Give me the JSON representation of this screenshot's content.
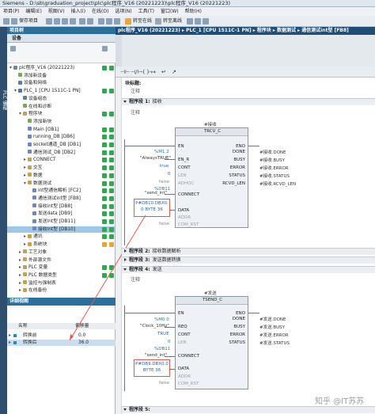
{
  "window": {
    "title": "Siemens - D:\\sb\\graduation_project\\plc\\plc程序_V16 (20221223)\\plc程序_V16 (20221223)"
  },
  "menu": [
    "项目(P)",
    "编辑(E)",
    "视图(V)",
    "插入(I)",
    "在线(O)",
    "选项(N)",
    "工具(T)",
    "窗口(W)",
    "帮助(H)"
  ],
  "toolbar": {
    "save_label": "保存项目",
    "go_online": "转至在线",
    "go_offline": "转至离线"
  },
  "left_tab": "PLC 编程",
  "project_tree": {
    "header": "项目树",
    "device_tab": "设备",
    "items": [
      {
        "label": "plc程序_V16 (20221223)",
        "indent": 0,
        "open": true,
        "icon": "#6a88a6",
        "status": "g"
      },
      {
        "label": "添加新设备",
        "indent": 1,
        "open": null,
        "icon": "#7aa85a",
        "status": ""
      },
      {
        "label": "设备和网络",
        "indent": 1,
        "open": null,
        "icon": "#5a7ea6",
        "status": ""
      },
      {
        "label": "PLC_1 [CPU 1511C-1 PN]",
        "indent": 1,
        "open": true,
        "icon": "#4a7a9a",
        "status": "g"
      },
      {
        "label": "设备组态",
        "indent": 2,
        "open": null,
        "icon": "#5a7ea6",
        "status": ""
      },
      {
        "label": "在线和诊断",
        "indent": 2,
        "open": null,
        "icon": "#7aa85a",
        "status": ""
      },
      {
        "label": "程序块",
        "indent": 2,
        "open": true,
        "icon": "#c8a04a",
        "status": "g"
      },
      {
        "label": "添加新块",
        "indent": 3,
        "open": null,
        "icon": "#7aa85a",
        "status": ""
      },
      {
        "label": "Main [OB1]",
        "indent": 3,
        "open": null,
        "icon": "#6a88c6",
        "status": "g"
      },
      {
        "label": "running_DB [DB6]",
        "indent": 3,
        "open": null,
        "icon": "#6a88c6",
        "status": "g"
      },
      {
        "label": "socket通道_DB [DB1]",
        "indent": 3,
        "open": null,
        "icon": "#6a88c6",
        "status": "g"
      },
      {
        "label": "通信测试_DB [DB2]",
        "indent": 3,
        "open": null,
        "icon": "#6a88c6",
        "status": "g"
      },
      {
        "label": "CONNECT",
        "indent": 3,
        "open": false,
        "icon": "#c8a04a",
        "status": "g"
      },
      {
        "label": "交互",
        "indent": 3,
        "open": false,
        "icon": "#c8a04a",
        "status": "g"
      },
      {
        "label": "数据",
        "indent": 3,
        "open": false,
        "icon": "#c8a04a",
        "status": "g"
      },
      {
        "label": "数据测试",
        "indent": 3,
        "open": true,
        "icon": "#c8a04a",
        "status": "g"
      },
      {
        "label": "int型通信解析 [FC2]",
        "indent": 4,
        "open": null,
        "icon": "#6a88c6",
        "status": "g"
      },
      {
        "label": "通信测试int型 [FB8]",
        "indent": 4,
        "open": null,
        "icon": "#6a88c6",
        "status": "g"
      },
      {
        "label": "接收int型 [DB8]",
        "indent": 4,
        "open": null,
        "icon": "#6a88c6",
        "status": "g"
      },
      {
        "label": "发送data [DB9]",
        "indent": 4,
        "open": null,
        "icon": "#6a88c6",
        "status": "g"
      },
      {
        "label": "发送int型 [DB11]",
        "indent": 4,
        "open": null,
        "icon": "#6a88c6",
        "status": "g"
      },
      {
        "label": "接收int型 [DB10]",
        "indent": 4,
        "open": null,
        "icon": "#6a88c6",
        "status": "g",
        "selected": true
      },
      {
        "label": "通讯",
        "indent": 3,
        "open": false,
        "icon": "#c8a04a",
        "status": "g"
      },
      {
        "label": "系统块",
        "indent": 3,
        "open": false,
        "icon": "#c8a04a",
        "status": "o"
      },
      {
        "label": "工艺对象",
        "indent": 2,
        "open": false,
        "icon": "#c8a04a",
        "status": ""
      },
      {
        "label": "外部源文件",
        "indent": 2,
        "open": false,
        "icon": "#c8a04a",
        "status": ""
      },
      {
        "label": "PLC 变量",
        "indent": 2,
        "open": false,
        "icon": "#c8a04a",
        "status": "g"
      },
      {
        "label": "PLC 数据类型",
        "indent": 2,
        "open": false,
        "icon": "#c8a04a",
        "status": "g"
      },
      {
        "label": "监控与强制表",
        "indent": 2,
        "open": false,
        "icon": "#c8a04a",
        "status": ""
      },
      {
        "label": "在线备份",
        "indent": 2,
        "open": false,
        "icon": "#c8a04a",
        "status": ""
      }
    ]
  },
  "details": {
    "header": "详细视图",
    "col_name": "名称",
    "col_value": "偏移量",
    "rows": [
      {
        "name": "转换前",
        "value": "0.0"
      },
      {
        "name": "转换后",
        "value": "36.0"
      }
    ]
  },
  "editor": {
    "breadcrumb": "plc程序_V16 (20221223) ▸ PLC_1 [CPU 1511C-1 PN] ▸ 程序块 ▸ 数据测试 ▸ 通信测试int型 [FB8]",
    "toolbar_glyphs": [
      "⊣⊢",
      "⊣/⊢",
      "-( )-",
      "↦",
      "↵",
      "↗"
    ],
    "block_title": "块标题:",
    "block_comment": "注释",
    "networks": [
      {
        "label": "程序段 1:",
        "title": "接收",
        "comment": "注释"
      },
      {
        "label": "程序段 2:",
        "title": "接收数据解析",
        "comment": ""
      },
      {
        "label": "程序段 3:",
        "title": "发送数据转换",
        "comment": ""
      },
      {
        "label": "程序段 4:",
        "title": "发送",
        "comment": "注释"
      },
      {
        "label": "程序段 5:",
        "title": "",
        "comment": ""
      }
    ],
    "trcv": {
      "instance": "#接收",
      "name": "TRCV_C",
      "en": "EN",
      "eno": "ENO",
      "inputs": [
        "EN_R",
        "CONT",
        "LEN",
        "ADHOC",
        "CONNECT",
        "DATA",
        "ADDR",
        "COM_RST"
      ],
      "outputs": [
        "DONE",
        "BUSY",
        "ERROR",
        "STATUS",
        "RCVD_LEN"
      ],
      "out_vars": [
        "#接收.DONE",
        "#接收.BUSY",
        "#接收.ERROR",
        "#接收.STATUS",
        "#接收.RCVD_LEN"
      ],
      "en_r_addr": "%M1.2",
      "en_r_tag": "\"AlwaysTRUE\"",
      "cont_val": "true",
      "len_val": "0",
      "adhoc_val": "false",
      "connect_addr": "%DB11",
      "connect_tag": "\"send_int\"",
      "data_line1": "P#DB10.DBX0.",
      "data_line2": "0 BYTE 36",
      "comrst_val": "false"
    },
    "tsend": {
      "instance": "#发送",
      "name": "TSEND_C",
      "en": "EN",
      "eno": "ENO",
      "inputs": [
        "REQ",
        "CONT",
        "LEN",
        "CONNECT",
        "DATA",
        "ADDR",
        "COM_RST"
      ],
      "outputs": [
        "DONE",
        "BUSY",
        "ERROR",
        "STATUS"
      ],
      "out_vars": [
        "#发送.DONE",
        "#发送.BUSY",
        "#发送.ERROR",
        "#发送.STATUS"
      ],
      "req_addr": "%M0.0",
      "req_tag": "\"Clock_10Hz\"",
      "cont_val": "TRUE",
      "len_val": "0",
      "connect_addr": "%DB11",
      "connect_tag": "\"send_int\"",
      "data_line1": "P#DB9.DBX0.0",
      "data_line2": "BYTE 36",
      "comrst_val": "false"
    }
  },
  "watermark": "知乎 @IT苏苏",
  "colors": {
    "accent": "#1f4e79",
    "highlight": "#e25a4a",
    "ok": "#2fa84f"
  }
}
